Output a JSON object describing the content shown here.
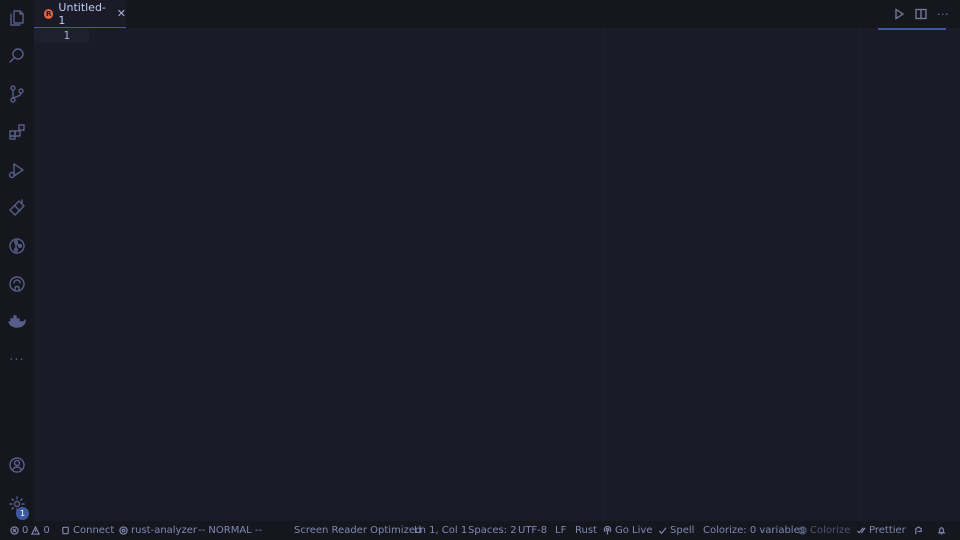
{
  "editor_tab": {
    "title": "Untitled-1",
    "icon_glyph": "R",
    "close_glyph": "✕"
  },
  "editor": {
    "line_numbers": [
      "1"
    ]
  },
  "activity_bar": {
    "items": [
      {
        "name": "explorer-icon"
      },
      {
        "name": "search-icon"
      },
      {
        "name": "source-control-icon"
      },
      {
        "name": "extensions-icon"
      },
      {
        "name": "run-debug-icon"
      },
      {
        "name": "testing-flask-icon"
      },
      {
        "name": "git-graph-icon"
      },
      {
        "name": "github-icon"
      },
      {
        "name": "docker-icon"
      },
      {
        "name": "more-icon"
      }
    ],
    "more_glyph": "···",
    "settings_badge": "1"
  },
  "editor_actions": {
    "more_glyph": "···"
  },
  "status_bar": {
    "errors": "0",
    "warnings": "0",
    "connect": "Connect",
    "rust_analyzer": "rust-analyzer",
    "vim_mode": "-- NORMAL --",
    "screen_reader": "Screen Reader Optimized",
    "cursor_position": "Ln 1, Col 1",
    "spaces": "Spaces: 2",
    "encoding": "UTF-8",
    "eol": "LF",
    "language": "Rust",
    "go_live": "Go Live",
    "spell": "Spell",
    "colorize_vars": "Colorize: 0 variables",
    "colorize": "Colorize",
    "prettier": "Prettier"
  },
  "colors": {
    "background": "#1a1b26",
    "sidebar": "#16161e",
    "accent": "#3d59a1",
    "rust_icon": "#e0623f"
  }
}
